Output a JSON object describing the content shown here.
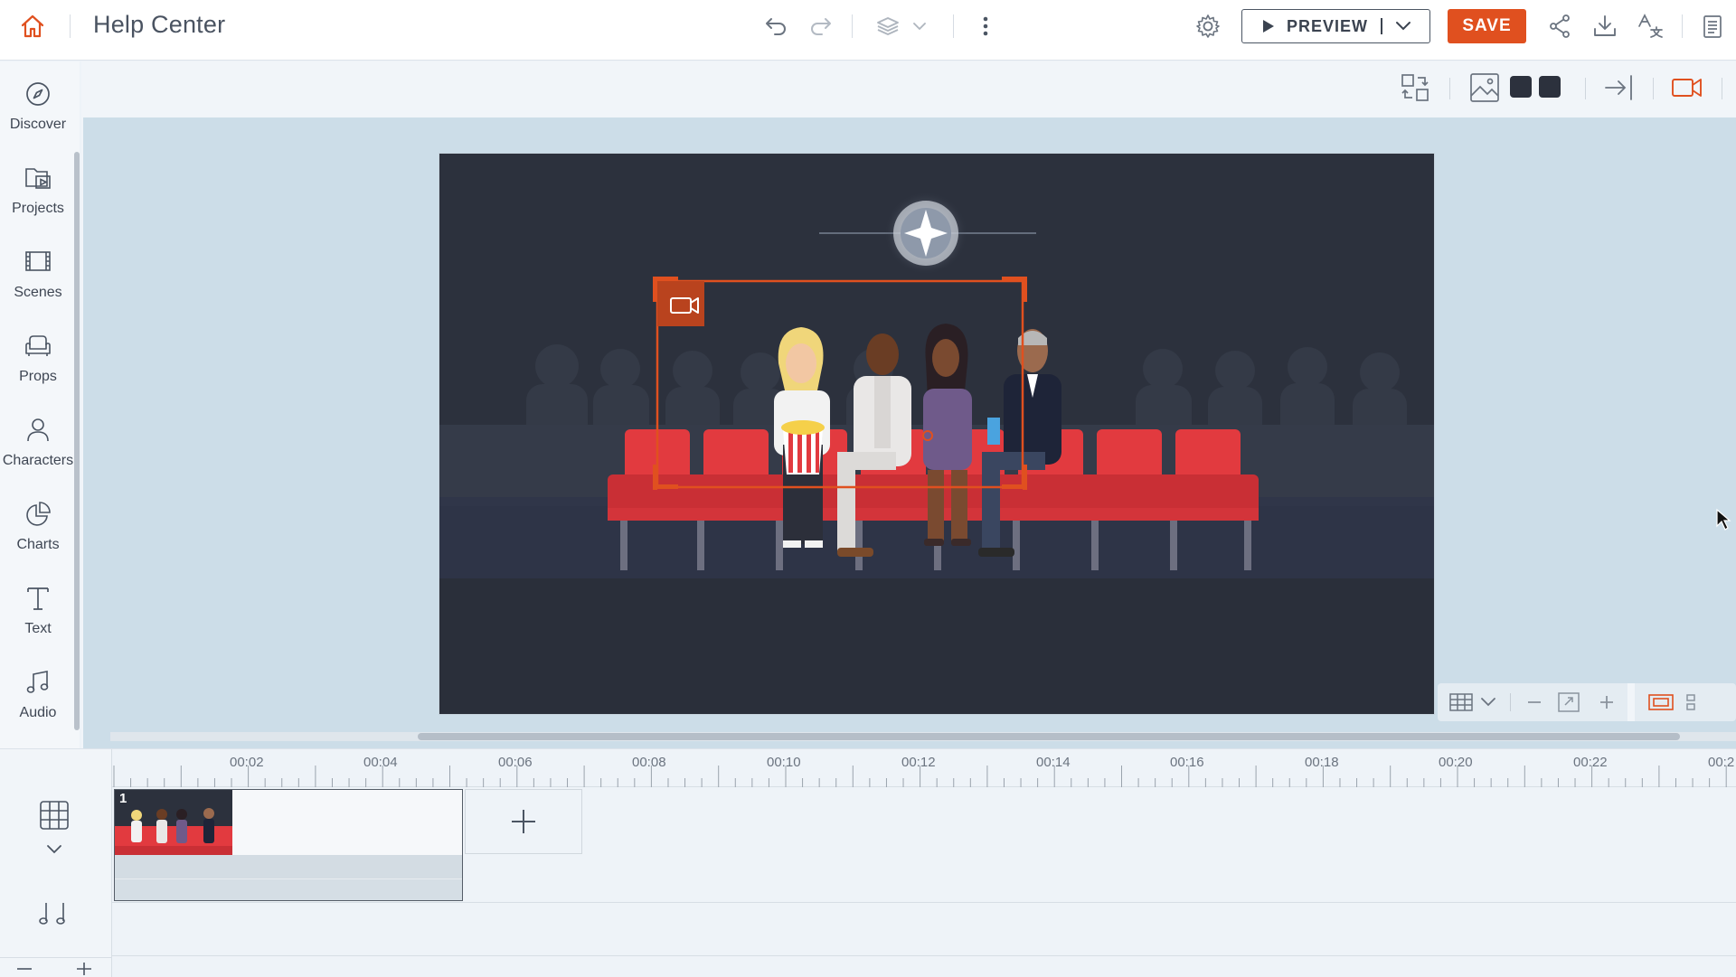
{
  "header": {
    "title": "Help Center",
    "preview_label": "PREVIEW",
    "save_label": "SAVE"
  },
  "sidebar": {
    "items": [
      {
        "label": "Discover",
        "icon": "compass-icon"
      },
      {
        "label": "Projects",
        "icon": "projects-folder-icon"
      },
      {
        "label": "Scenes",
        "icon": "scenes-film-icon"
      },
      {
        "label": "Props",
        "icon": "props-couch-icon"
      },
      {
        "label": "Characters",
        "icon": "character-icon"
      },
      {
        "label": "Charts",
        "icon": "pie-chart-icon"
      },
      {
        "label": "Text",
        "icon": "text-icon"
      },
      {
        "label": "Audio",
        "icon": "music-note-icon"
      }
    ]
  },
  "timeline": {
    "ticks": [
      "00:02",
      "00:04",
      "00:06",
      "00:08",
      "00:10",
      "00:12",
      "00:14",
      "00:16",
      "00:18",
      "00:20",
      "00:22",
      "00:2"
    ],
    "scenes": [
      {
        "number": "1"
      }
    ]
  },
  "colors": {
    "accent": "#e0501f",
    "stage_bg": "#2c313d",
    "seat_red": "#e23a3f",
    "selection": "#e0501f"
  }
}
